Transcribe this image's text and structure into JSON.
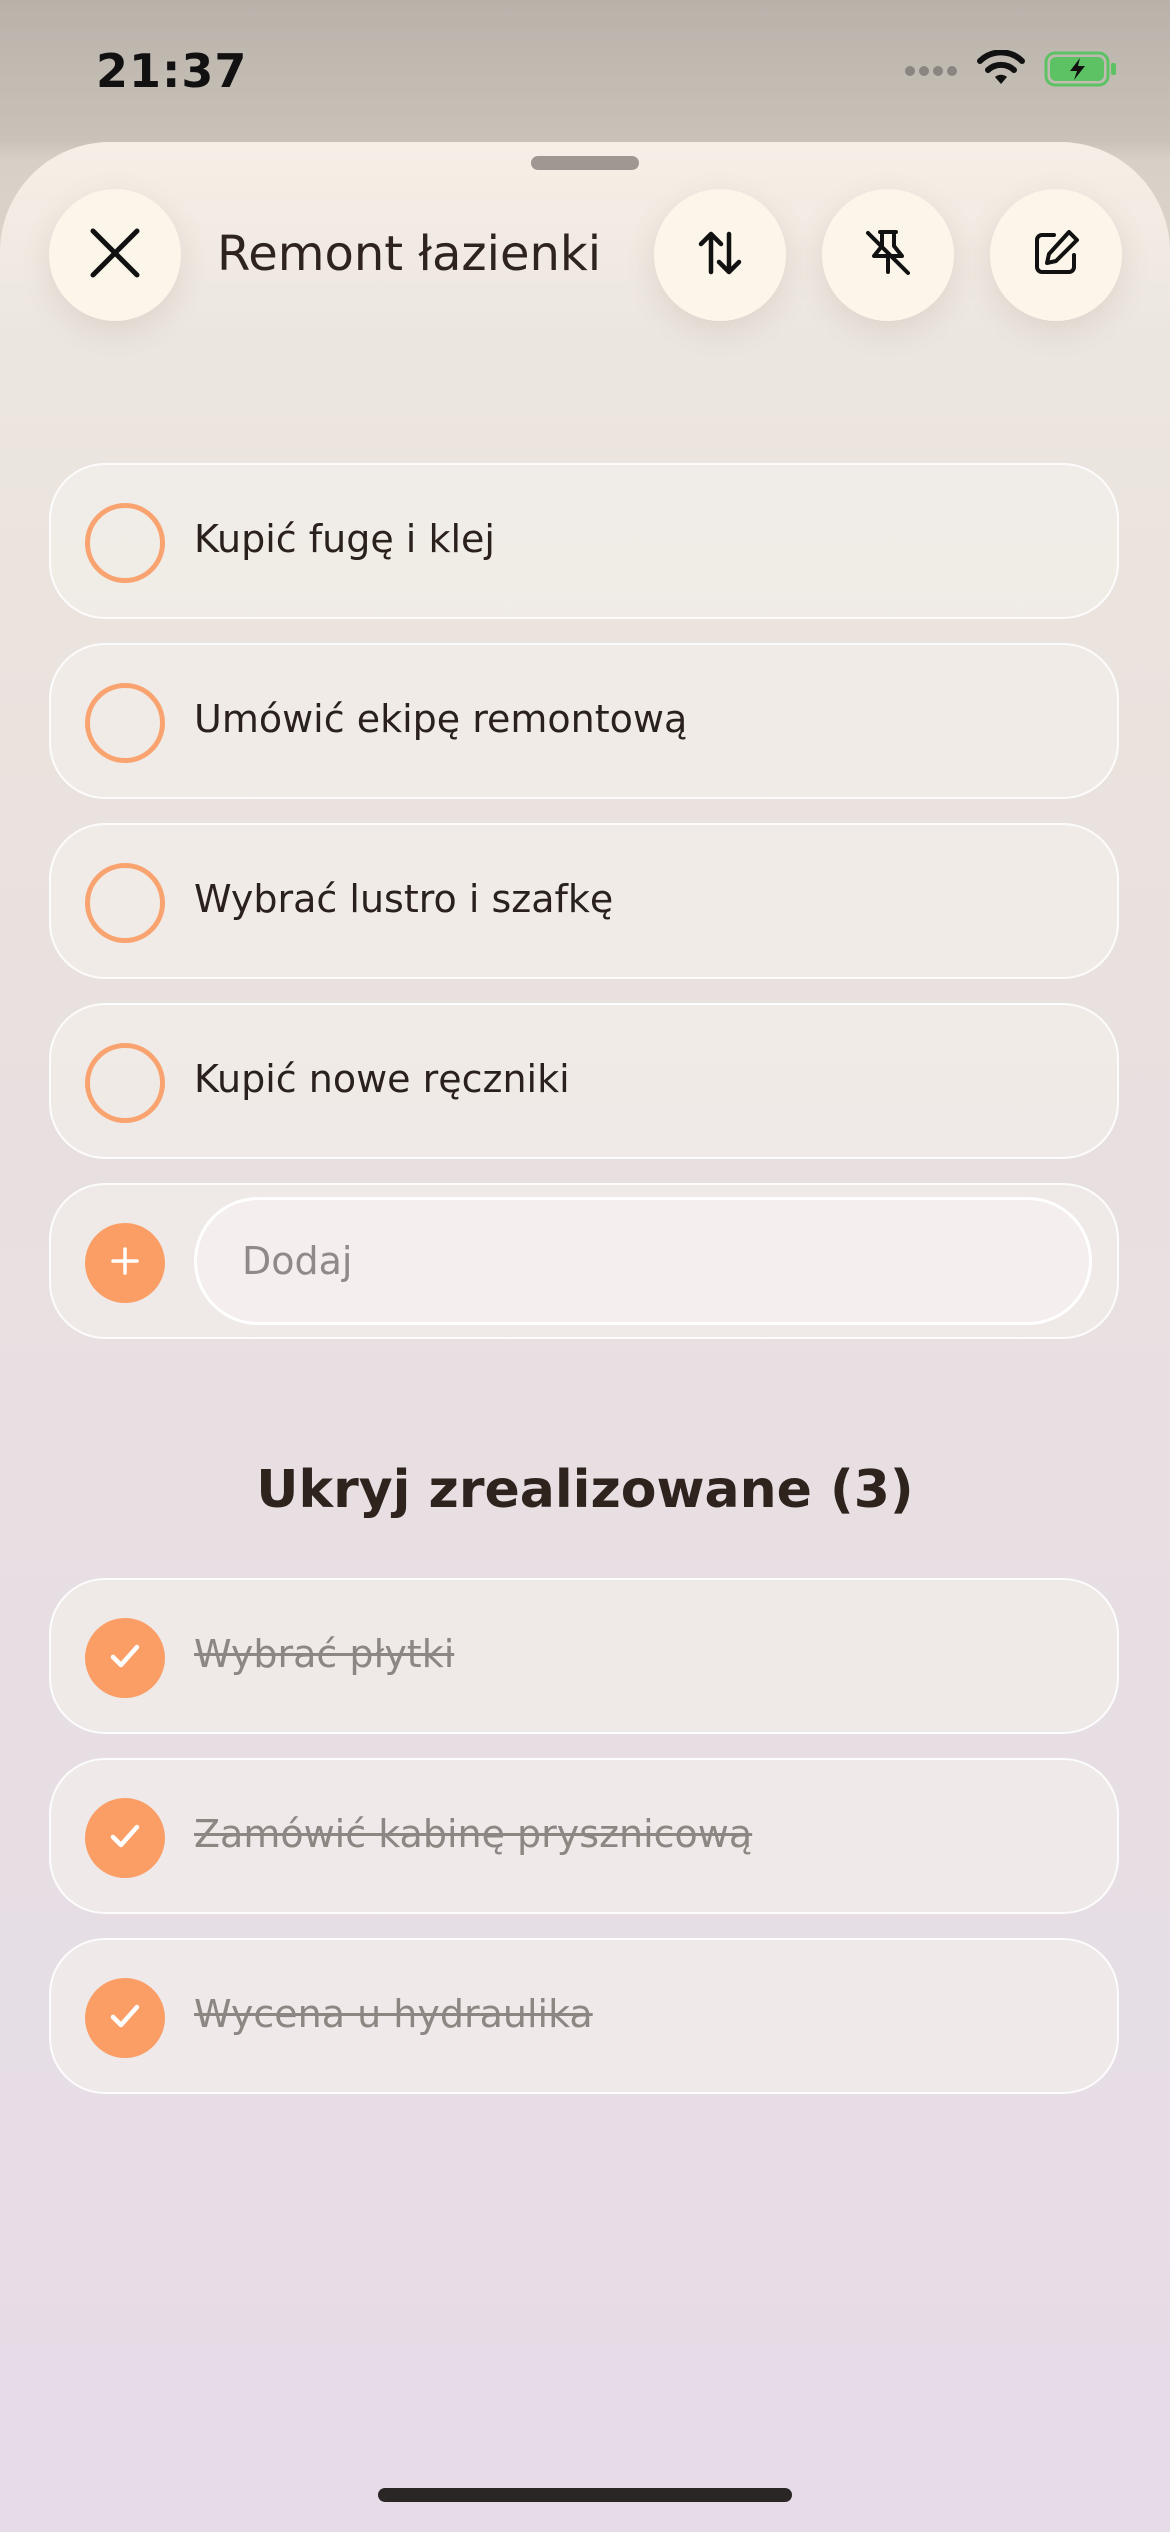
{
  "status_bar": {
    "time": "21:37",
    "signal_icon": "signal-dots-icon",
    "wifi_icon": "wifi-icon",
    "battery_icon": "battery-charging-icon",
    "battery_color": "#5cc264"
  },
  "header": {
    "title": "Remont łazienki",
    "close_icon": "close-icon",
    "sort_icon": "sort-arrows-icon",
    "unpin_icon": "pin-off-icon",
    "edit_icon": "edit-icon"
  },
  "tasks": {
    "open": [
      {
        "label": "Kupić fugę i klej"
      },
      {
        "label": "Umówić ekipę remontową"
      },
      {
        "label": "Wybrać lustro i szafkę"
      },
      {
        "label": "Kupić nowe ręczniki"
      }
    ],
    "add": {
      "placeholder": "Dodaj",
      "icon": "plus-icon"
    },
    "completed_toggle": "Ukryj zrealizowane (3)",
    "completed": [
      {
        "label": "Wybrać płytki"
      },
      {
        "label": "Zamówić kabinę prysznicową"
      },
      {
        "label": "Wycena u hydraulika"
      }
    ]
  },
  "colors": {
    "accent": "#fa9e66",
    "text": "#2e231d",
    "completed_text": "#8d8784"
  }
}
